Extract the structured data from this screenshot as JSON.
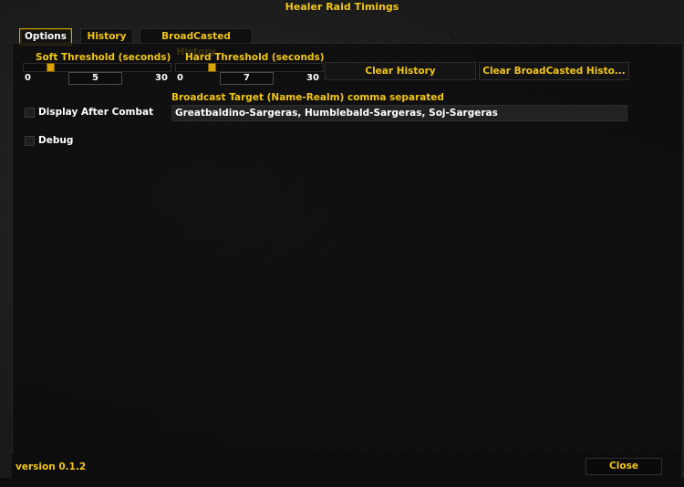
{
  "window": {
    "title": "Healer Raid Timings"
  },
  "tabs": [
    {
      "label": "Options",
      "active": true
    },
    {
      "label": "History",
      "active": false
    },
    {
      "label": "BroadCasted History",
      "active": false
    }
  ],
  "soft_threshold": {
    "label": "Soft Threshold (seconds)",
    "min": "0",
    "max": "30",
    "value": "5",
    "fraction": 0.1667
  },
  "hard_threshold": {
    "label": "Hard Threshold (seconds)",
    "min": "0",
    "max": "30",
    "value": "7",
    "fraction": 0.2333
  },
  "buttons": {
    "clear_history": "Clear History",
    "clear_broadcasted_history": "Clear BroadCasted Histo...",
    "close": "Close"
  },
  "broadcast_target": {
    "label": "Broadcast Target (Name-Realm) comma separated",
    "value": "Greatbaldino-Sargeras, Humblebald-Sargeras, Soj-Sargeras"
  },
  "checkboxes": {
    "display_after_combat": {
      "label": "Display After Combat",
      "checked": false
    },
    "debug": {
      "label": "Debug",
      "checked": false
    }
  },
  "footer": {
    "version": "version 0.1.2"
  },
  "colors": {
    "accent": "#f2c611",
    "background": "#1b1b1b"
  }
}
